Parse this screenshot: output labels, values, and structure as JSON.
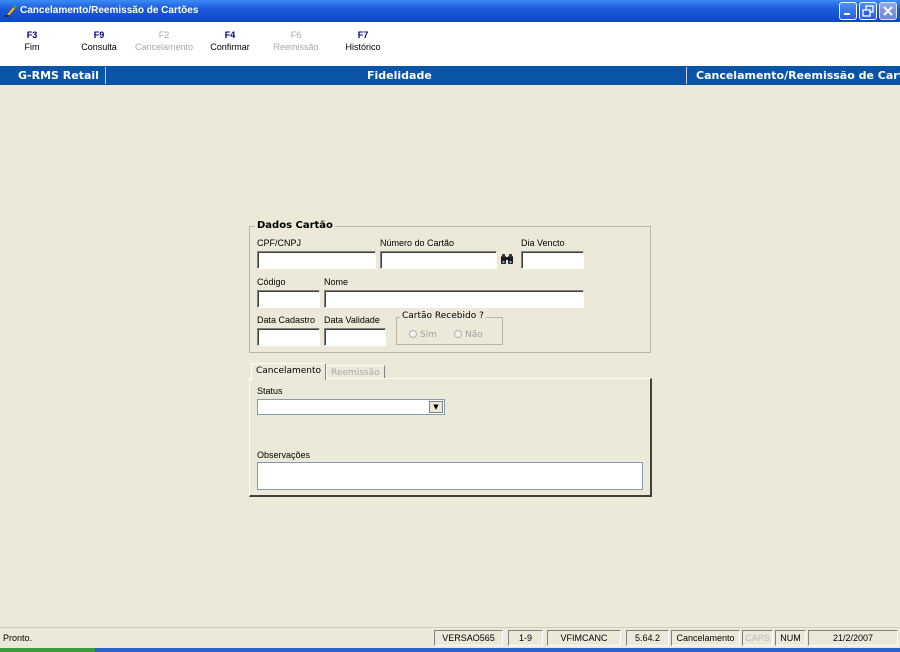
{
  "window": {
    "title": "Cancelamento/Reemissão de Cartões",
    "icon": "app-pen-icon",
    "controls": [
      "minimize-icon",
      "restore-icon",
      "close-icon"
    ]
  },
  "toolbar": {
    "keys": [
      {
        "key": "F3",
        "label": "Fim",
        "enabled": true
      },
      {
        "key": "F9",
        "label": "Consulta",
        "enabled": true
      },
      {
        "key": "F2",
        "label": "Cancelamento",
        "enabled": false
      },
      {
        "key": "F4",
        "label": "Confirmar",
        "enabled": true
      },
      {
        "key": "F6",
        "label": "Reemissão",
        "enabled": false
      },
      {
        "key": "F7",
        "label": "Histórico",
        "enabled": true
      }
    ]
  },
  "header": {
    "left": "G-RMS Retail",
    "center": "Fidelidade",
    "right": "Cancelamento/Reemissão de Cartões"
  },
  "dados_cartao": {
    "title": "Dados Cartão",
    "cpf_label": "CPF/CNPJ",
    "cpf_value": "",
    "numero_label": "Número do Cartão",
    "numero_value": "",
    "search_icon": "binoculars-icon",
    "vencto_label": "Dia Vencto",
    "vencto_value": "",
    "codigo_label": "Código",
    "codigo_value": "",
    "nome_label": "Nome",
    "nome_value": "",
    "cadastro_label": "Data Cadastro",
    "cadastro_value": "",
    "validade_label": "Data Validade",
    "validade_value": "",
    "recebido_title": "Cartão Recebido ?",
    "recebido_options": [
      "Sim",
      "Não"
    ]
  },
  "tabs": [
    {
      "label": "Cancelamento",
      "active": true
    },
    {
      "label": "Reemissão",
      "active": false
    }
  ],
  "cancelamento": {
    "status_label": "Status",
    "status_value": "",
    "obs_label": "Observações",
    "obs_value": ""
  },
  "statusbar": {
    "message": "Pronto.",
    "panes": [
      "VERSAO565",
      "1-9",
      "VFIMCANC",
      "5.64.2",
      "Cancelamento",
      "CAPS",
      "NUM",
      "21/2/2007"
    ]
  },
  "colors": {
    "titlebar": "#0b48c8",
    "band": "#0a55a8",
    "fkey": "#000080",
    "background": "#ECE9D8"
  }
}
